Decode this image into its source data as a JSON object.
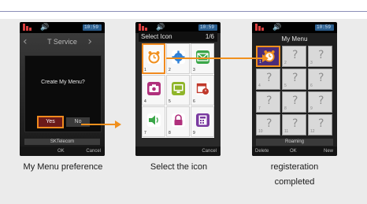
{
  "status_bar": {
    "battery_label": "10:59"
  },
  "phone1": {
    "title": "T Service",
    "dialog_question": "Create My Menu?",
    "yes_label": "Yes",
    "no_label": "No",
    "carrier": "SKTelecom",
    "softkeys": {
      "center": "OK",
      "right": "Cancel"
    }
  },
  "phone2": {
    "title_bg": "T Service",
    "title": "Select Icon",
    "page": "1/6",
    "icons": [
      {
        "num": "1",
        "icon": "alarm-clock-icon"
      },
      {
        "num": "2",
        "icon": "gear-icon"
      },
      {
        "num": "3",
        "icon": "envelope-icon"
      },
      {
        "num": "4",
        "icon": "camera-icon"
      },
      {
        "num": "5",
        "icon": "monitor-icon"
      },
      {
        "num": "6",
        "icon": "calendar-clock-icon"
      },
      {
        "num": "7",
        "icon": "speaker-icon"
      },
      {
        "num": "8",
        "icon": "lock-icon"
      },
      {
        "num": "9",
        "icon": "calculator-icon"
      }
    ],
    "softkeys": {
      "right": "Cancel"
    }
  },
  "phone3": {
    "title": "My Menu",
    "slot_placeholder": "?",
    "slots": [
      "1",
      "2",
      "3",
      "4",
      "5",
      "6",
      "7",
      "8",
      "9",
      "10",
      "11",
      "12"
    ],
    "roaming": "Roaming",
    "softkeys": {
      "left": "Delete",
      "center": "OK",
      "right": "New"
    }
  },
  "captions": {
    "step1": "My Menu preference",
    "step2": "Select the icon",
    "step3_line1": "registeration",
    "step3_line2": "completed"
  },
  "colors": {
    "highlight": "#f0901e"
  }
}
